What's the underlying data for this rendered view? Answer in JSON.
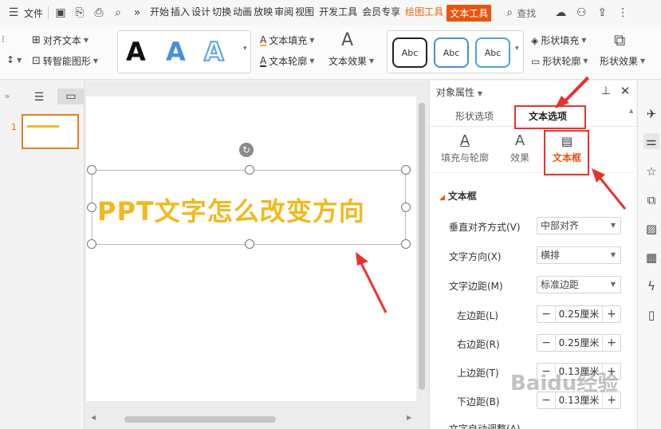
{
  "menubar": {
    "file_label": "文件",
    "tabs": [
      "开始",
      "插入",
      "设计",
      "切换",
      "动画",
      "放映",
      "审阅",
      "视图",
      "开发工具",
      "会员专享"
    ],
    "drawing_tools": "绘图工具",
    "text_tools": "文本工具",
    "search_label": "查找"
  },
  "ribbon": {
    "align_text": "对齐文本",
    "smartart": "转智能图形",
    "text_fill": "文本填充",
    "text_outline": "文本轮廓",
    "text_effect": "文本效果",
    "style_letter": "A",
    "abc": "Abc",
    "shape_fill": "形状填充",
    "shape_outline": "形状轮廓",
    "shape_effect": "形状效果"
  },
  "slides": {
    "number": "1"
  },
  "canvas": {
    "slide_text": "PPT文字怎么改变方向"
  },
  "panel": {
    "title": "对象属性",
    "tab_shape": "形状选项",
    "tab_text": "文本选项",
    "sub_fill": "填充与轮廓",
    "sub_effect": "效果",
    "sub_textbox": "文本框",
    "section": "文本框",
    "rows": {
      "valign_label": "垂直对齐方式(V)",
      "valign_value": "中部对齐",
      "dir_label": "文字方向(X)",
      "dir_value": "横排",
      "margin_label": "文字边距(M)",
      "margin_value": "标准边距",
      "left_label": "左边距(L)",
      "left_value": "0.25厘米",
      "right_label": "右边距(R)",
      "right_value": "0.25厘米",
      "top_label": "上边距(T)",
      "top_value": "0.13厘米",
      "bottom_label": "下边距(B)",
      "bottom_value": "0.13厘米",
      "autofit_label": "文字自动调整(A)"
    }
  },
  "watermark": "Baidu经验",
  "colors": {
    "accent": "#e8540f",
    "annotation": "#e8322c",
    "slide_text": "#f4b81c"
  }
}
